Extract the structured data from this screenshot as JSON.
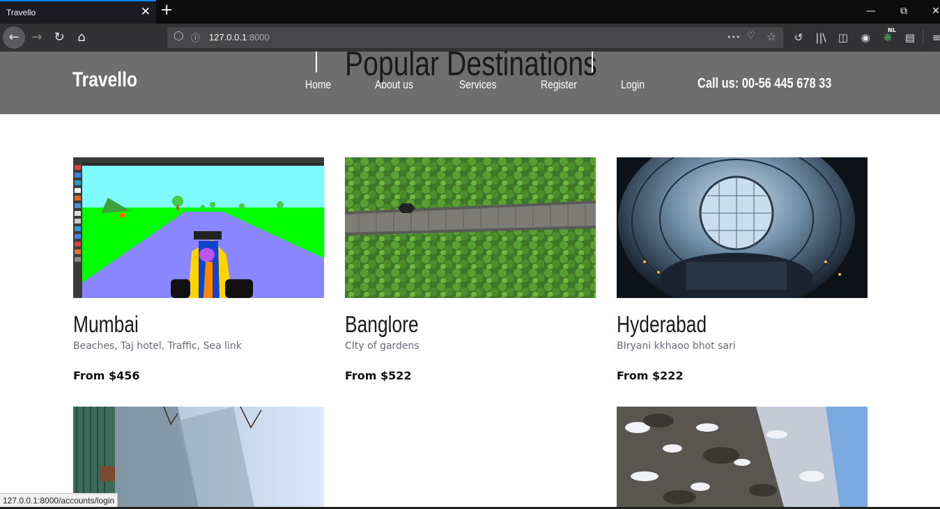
{
  "browser": {
    "tab_title": "Travello",
    "tab_close": "✕",
    "new_tab": "+",
    "url_host": "127.0.0.1",
    "url_port": ":8000",
    "url_more": "•••",
    "status_url": "127.0.0.1:8000/accounts/login",
    "profile_badge": "NL",
    "colors": {
      "tabbar": "#0c0c0d",
      "toolbar": "#323234",
      "urlbar": "#474749",
      "accent": "#0a84ff"
    }
  },
  "header": {
    "logo": "Travello",
    "nav": [
      "Home",
      "About us",
      "Services",
      "Register",
      "Login"
    ],
    "call": "Call us: 00-56 445 678 33",
    "background": "#6e6e6e"
  },
  "section_title": "Popular Destinations",
  "destinations": [
    {
      "title": "Mumbai",
      "desc": "Beaches, Taj hotel, Traffic, Sea link",
      "price": "From $456",
      "image": "game-screenshot"
    },
    {
      "title": "Banglore",
      "desc": "CIty of gardens",
      "price": "From $522",
      "image": "boardwalk-aerial"
    },
    {
      "title": "Hyderabad",
      "desc": "BIryani kkhaoo bhot sari",
      "price": "From $222",
      "image": "glass-dome"
    }
  ],
  "row2_images": [
    "hillside-view",
    "snowy-rocks"
  ]
}
